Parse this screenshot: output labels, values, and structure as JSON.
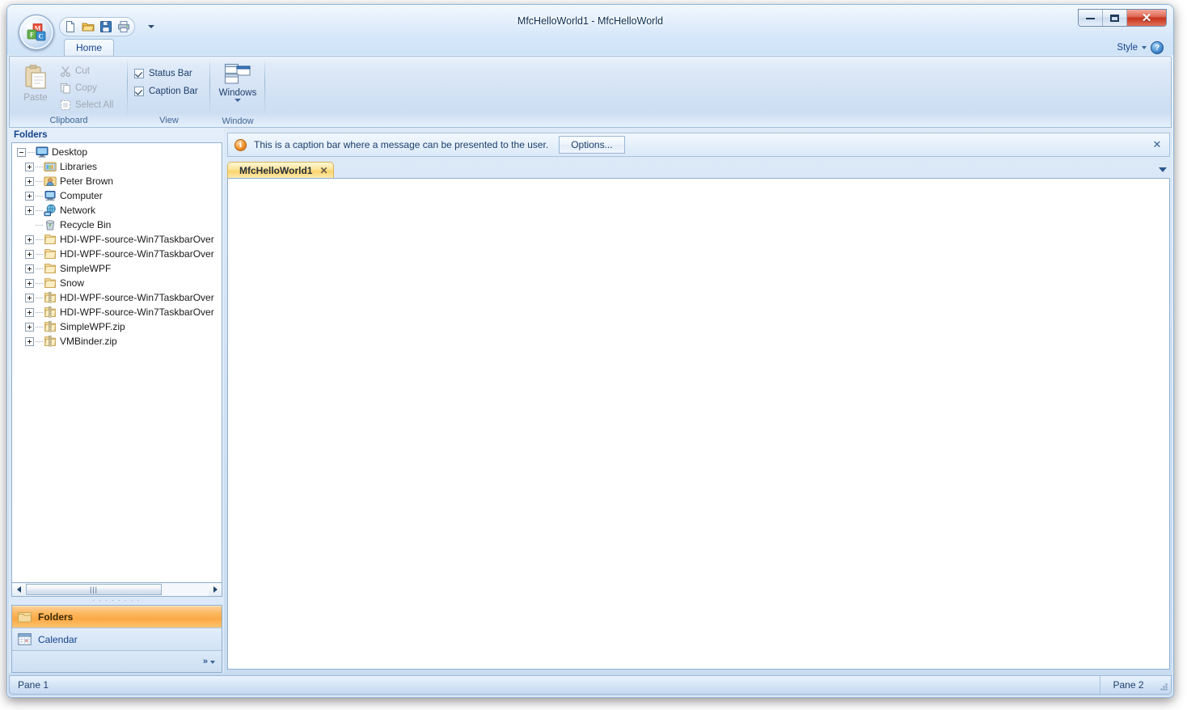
{
  "window": {
    "title": "MfcHelloWorld1 - MfcHelloWorld",
    "minimize_label": "",
    "maximize_label": "",
    "close_label": "✕"
  },
  "quick_access": {
    "items": [
      {
        "name": "new-icon",
        "tooltip": "New"
      },
      {
        "name": "open-icon",
        "tooltip": "Open"
      },
      {
        "name": "save-icon",
        "tooltip": "Save"
      },
      {
        "name": "print-icon",
        "tooltip": "Print"
      }
    ],
    "customize_label": ""
  },
  "style_area": {
    "label": "Style",
    "help_label": "?"
  },
  "ribbon": {
    "tabs": [
      {
        "label": "Home",
        "active": true
      }
    ],
    "groups": [
      {
        "label": "Clipboard",
        "paste_label": "Paste",
        "commands": [
          {
            "label": "Cut",
            "icon": "cut-icon",
            "enabled": false
          },
          {
            "label": "Copy",
            "icon": "copy-icon",
            "enabled": false
          },
          {
            "label": "Select All",
            "icon": "select-all-icon",
            "enabled": false
          }
        ]
      },
      {
        "label": "View",
        "checkboxes": [
          {
            "label": "Status Bar",
            "checked": true
          },
          {
            "label": "Caption Bar",
            "checked": true
          }
        ]
      },
      {
        "label": "Window",
        "windows_label": "Windows"
      }
    ]
  },
  "left_pane": {
    "caption": "Folders",
    "tree": [
      {
        "label": "Desktop",
        "level": 0,
        "icon": "desktop-icon",
        "expander": "minus"
      },
      {
        "label": "Libraries",
        "level": 1,
        "icon": "libraries-icon",
        "expander": "plus"
      },
      {
        "label": "Peter Brown",
        "level": 1,
        "icon": "user-folder-icon",
        "expander": "plus"
      },
      {
        "label": "Computer",
        "level": 1,
        "icon": "computer-icon",
        "expander": "plus"
      },
      {
        "label": "Network",
        "level": 1,
        "icon": "network-icon",
        "expander": "plus"
      },
      {
        "label": "Recycle Bin",
        "level": 1,
        "icon": "recycle-bin-icon",
        "expander": "none"
      },
      {
        "label": "HDI-WPF-source-Win7TaskbarOver",
        "level": 1,
        "icon": "folder-icon",
        "expander": "plus"
      },
      {
        "label": "HDI-WPF-source-Win7TaskbarOver",
        "level": 1,
        "icon": "folder-icon",
        "expander": "plus"
      },
      {
        "label": "SimpleWPF",
        "level": 1,
        "icon": "folder-icon",
        "expander": "plus"
      },
      {
        "label": "Snow",
        "level": 1,
        "icon": "folder-icon",
        "expander": "plus"
      },
      {
        "label": "HDI-WPF-source-Win7TaskbarOver",
        "level": 1,
        "icon": "zip-icon",
        "expander": "plus"
      },
      {
        "label": "HDI-WPF-source-Win7TaskbarOver",
        "level": 1,
        "icon": "zip-icon",
        "expander": "plus"
      },
      {
        "label": "SimpleWPF.zip",
        "level": 1,
        "icon": "zip-icon",
        "expander": "plus"
      },
      {
        "label": "VMBinder.zip",
        "level": 1,
        "icon": "zip-icon",
        "expander": "plus"
      }
    ],
    "scrollbar": {
      "grip": "⫴"
    },
    "navbar": {
      "items": [
        {
          "label": "Folders",
          "icon": "folder-icon",
          "selected": true
        },
        {
          "label": "Calendar",
          "icon": "calendar-icon",
          "selected": false
        }
      ],
      "expand_label": "»"
    }
  },
  "caption_bar": {
    "icon": "info-icon",
    "icon_glyph": "i",
    "message": "This is a caption bar where a message can be presented to the user.",
    "button_label": "Options...",
    "close_label": "✕"
  },
  "document_tabs": {
    "tabs": [
      {
        "label": "MfcHelloWorld1",
        "active": true,
        "close_label": "✕"
      }
    ],
    "menu_label": ""
  },
  "status_bar": {
    "pane1": "Pane 1",
    "pane2": "Pane 2"
  },
  "colors": {
    "accent_orange": "#fba945",
    "tab_yellow": "#fbd46a",
    "frame_blue": "#8fb4d9",
    "close_red": "#c6341c",
    "text_blue": "#15428b"
  }
}
